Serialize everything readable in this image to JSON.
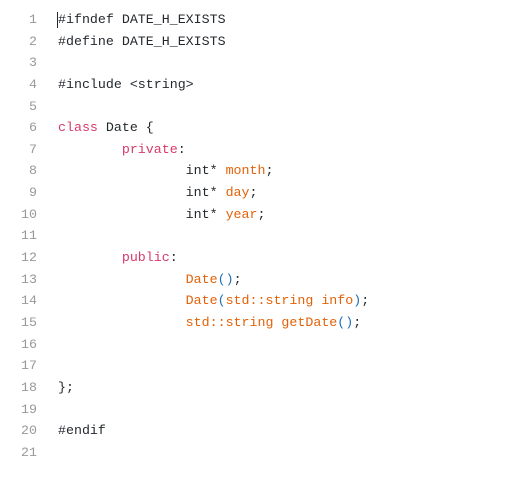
{
  "editor": {
    "colors": {
      "keyword": "#d73a6a",
      "identifier": "#e36209",
      "paren": "#1f6fb5",
      "text": "#24292e",
      "line_number": "#999999"
    },
    "lines": [
      [
        [
          "d",
          "#ifndef DATE_H_EXISTS"
        ]
      ],
      [
        [
          "d",
          "#define DATE_H_EXISTS"
        ]
      ],
      [],
      [
        [
          "d",
          "#include <string>"
        ]
      ],
      [],
      [
        [
          "kw",
          "class"
        ],
        [
          "d",
          " Date {"
        ]
      ],
      [
        [
          "d",
          "        "
        ],
        [
          "kw",
          "private"
        ],
        [
          "d",
          ":"
        ]
      ],
      [
        [
          "d",
          "                int* "
        ],
        [
          "fn",
          "month"
        ],
        [
          "d",
          ";"
        ]
      ],
      [
        [
          "d",
          "                int* "
        ],
        [
          "fn",
          "day"
        ],
        [
          "d",
          ";"
        ]
      ],
      [
        [
          "d",
          "                int* "
        ],
        [
          "fn",
          "year"
        ],
        [
          "d",
          ";"
        ]
      ],
      [],
      [
        [
          "d",
          "        "
        ],
        [
          "kw",
          "public"
        ],
        [
          "d",
          ":"
        ]
      ],
      [
        [
          "d",
          "                "
        ],
        [
          "fn",
          "Date"
        ],
        [
          "p",
          "()"
        ],
        [
          "d",
          ";"
        ]
      ],
      [
        [
          "d",
          "                "
        ],
        [
          "fn",
          "Date"
        ],
        [
          "p",
          "("
        ],
        [
          "fn",
          "std::string info"
        ],
        [
          "p",
          ")"
        ],
        [
          "d",
          ";"
        ]
      ],
      [
        [
          "d",
          "                "
        ],
        [
          "fn",
          "std::string getDate"
        ],
        [
          "p",
          "()"
        ],
        [
          "d",
          ";"
        ]
      ],
      [],
      [],
      [
        [
          "d",
          "};"
        ]
      ],
      [],
      [
        [
          "d",
          "#endif"
        ]
      ],
      []
    ]
  }
}
